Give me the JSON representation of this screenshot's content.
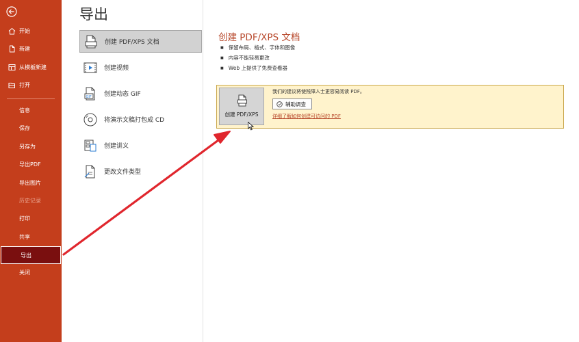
{
  "sidebar": {
    "items": [
      {
        "label": "开始",
        "icon": "home-icon"
      },
      {
        "label": "新建",
        "icon": "new-document-icon"
      },
      {
        "label": "从模板新建",
        "icon": "template-icon"
      },
      {
        "label": "打开",
        "icon": "folder-open-icon"
      },
      {
        "label": "信息"
      },
      {
        "label": "保存"
      },
      {
        "label": "另存为"
      },
      {
        "label": "导出PDF"
      },
      {
        "label": "导出图片"
      },
      {
        "label": "历史记录",
        "disabled": true
      },
      {
        "label": "打印"
      },
      {
        "label": "共享"
      },
      {
        "label": "导出",
        "selected": true
      },
      {
        "label": "关闭"
      }
    ]
  },
  "main": {
    "title": "导出",
    "options": [
      {
        "label": "创建 PDF/XPS 文档",
        "icon": "pdf-document-icon",
        "selected": true
      },
      {
        "label": "创建视频",
        "icon": "video-icon"
      },
      {
        "label": "创建动态 GIF",
        "icon": "gif-icon"
      },
      {
        "label": "将演示文稿打包成 CD",
        "icon": "cd-icon"
      },
      {
        "label": "创建讲义",
        "icon": "handout-icon"
      },
      {
        "label": "更改文件类型",
        "icon": "change-file-type-icon"
      }
    ]
  },
  "detail": {
    "title": "创建 PDF/XPS 文档",
    "bullets": [
      "保留布局、格式、字体和图像",
      "内容不能轻易更改",
      "Web 上提供了免费查看器"
    ],
    "create_button": "创建 PDF/XPS",
    "info_text": "我们的建议将使残障人士更容易阅读 PDF。",
    "assist_button": "辅助调查",
    "learn_link": "详细了解如何创建可访问的 PDF"
  },
  "colors": {
    "sidebar_bg": "#c43e1c",
    "sidebar_selected": "#7a0f0f",
    "accent_text": "#b7472a",
    "info_bg": "#fff3cc",
    "arrow": "#e0262d"
  }
}
